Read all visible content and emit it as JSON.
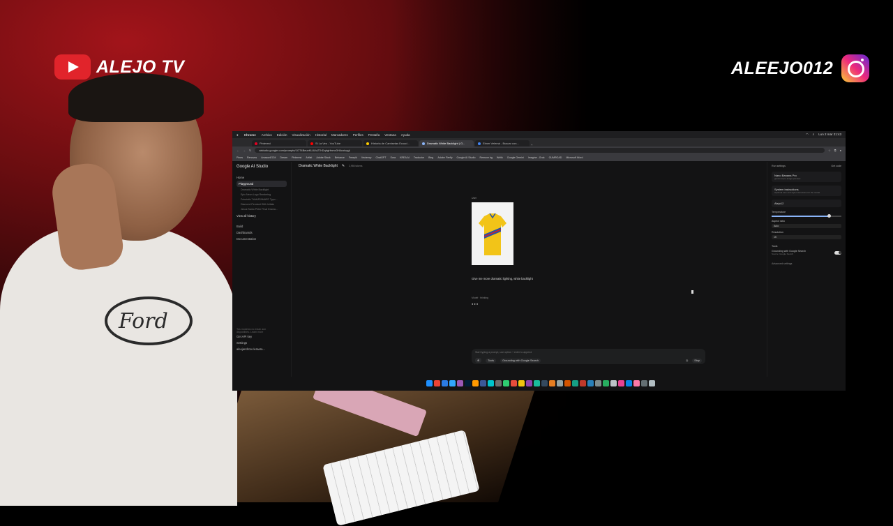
{
  "overlay": {
    "channel_name": "ALEJO TV",
    "instagram_handle": "ALEEJO012",
    "shirt_logo_text": "Ford"
  },
  "mac_menubar": {
    "app": "Chrome",
    "items": [
      "Archivo",
      "Edición",
      "Visualización",
      "Historial",
      "Marcadores",
      "Perfiles",
      "Pestaña",
      "Ventana",
      "Ayuda"
    ],
    "clock": "Lun 2 mar 21:43"
  },
  "browser": {
    "tabs": [
      {
        "label": "Pinterest",
        "active": false,
        "color": "#e60023"
      },
      {
        "label": "Si La Ves - YouTube",
        "active": false,
        "color": "#ff0000"
      },
      {
        "label": "Historia de Camisetas Ecuad...",
        "active": false,
        "color": "#ffcc00"
      },
      {
        "label": "Dramatic White Backlight | G...",
        "active": true,
        "color": "#8ab4f8"
      },
      {
        "label": "Elmer Velemá - Buscar con...",
        "active": false,
        "color": "#4285f4"
      }
    ],
    "url": "aistudio.google.com/prompts/1OT4BeuvKL8UvZ7hDqhgHnmx3H4coiuygl",
    "bookmarks": [
      "Pines",
      "Renovus",
      "AmazonECM",
      "Dream",
      "Pinterest",
      "Artlist",
      "Adobe Stock",
      "Behance",
      "Freepik",
      "Vecteezy",
      "ChatGPT",
      "Sora",
      "KREA AI",
      "Traductor",
      "Bing",
      "Adobe Firefly",
      "Google AI Studio",
      "Remove bg",
      "Writik",
      "Google Gemini",
      "Imagine - Grok",
      "GUMROAD",
      "Microsoft Word"
    ]
  },
  "studio": {
    "brand": "Google AI Studio",
    "nav": [
      "Home",
      "Playground",
      "Build",
      "Dashboards",
      "Documentation"
    ],
    "history": [
      "Dramatic White Backlight",
      "Epic Neon Logo Rendering",
      "Futuristic \"NAKATAMARI\" Typo...",
      "Diamond Pendant With Initials",
      "Jesus Santo Peter Final Drama..."
    ],
    "view_all": "View all history",
    "footer": {
      "notice": "Tus modelos no están aún disponibles. Learn more",
      "get_api_key": "Get API key",
      "settings": "Settings",
      "account": "aleejandroo.rieraara..."
    },
    "chat": {
      "title": "Dramatic White Backlight",
      "tokens": "2,955 tokens",
      "user_label": "User",
      "prompt": "Give me more dramatic lighting, white backlight",
      "model_label": "Model  ·  thinking",
      "loading": "●●●",
      "composer_placeholder": "Start typing a prompt, use option + enter to append",
      "tools": "Tools",
      "grounding_chip": "Grounding with Google Search",
      "stop": "Stop"
    },
    "run_settings": {
      "header": "Run settings",
      "get_code": "Get code",
      "model_name": "Nano Banana Pro",
      "model_desc": "gemini-3-pro-image-preview",
      "system_instructions": "System instructions",
      "system_desc": "Optional tone and style instructions for the model",
      "profile": "Alejo12",
      "temperature_label": "Temperature",
      "temperature": 1,
      "temperature_fraction": 0.82,
      "aspect_label": "Aspect ratio",
      "aspect_value": "Auto",
      "resolution_label": "Resolution",
      "resolution_value": "1K",
      "tools_label": "Tools",
      "grounding_label": "Grounding with Google Search",
      "grounding_sub": "Source: Google Search",
      "grounding_on": true,
      "advanced": "Advanced settings"
    }
  },
  "colors": {
    "accent": "#8ab4f8",
    "youtube_red": "#e1242b",
    "shirt_yellow": "#f2c418",
    "shirt_blue": "#2452a6"
  }
}
